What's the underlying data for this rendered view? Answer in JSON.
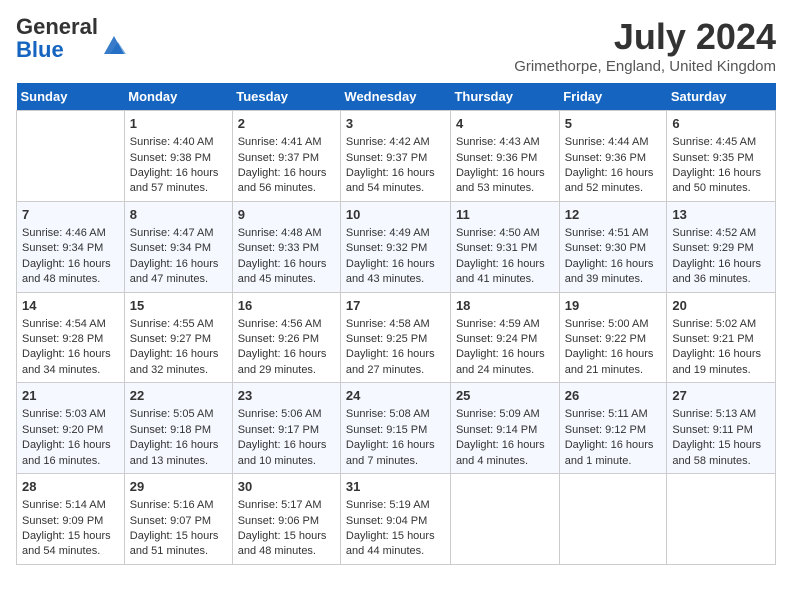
{
  "logo": {
    "general": "General",
    "blue": "Blue"
  },
  "title": "July 2024",
  "location": "Grimethorpe, England, United Kingdom",
  "days_of_week": [
    "Sunday",
    "Monday",
    "Tuesday",
    "Wednesday",
    "Thursday",
    "Friday",
    "Saturday"
  ],
  "weeks": [
    [
      {
        "day": "",
        "content": ""
      },
      {
        "day": "1",
        "content": "Sunrise: 4:40 AM\nSunset: 9:38 PM\nDaylight: 16 hours\nand 57 minutes."
      },
      {
        "day": "2",
        "content": "Sunrise: 4:41 AM\nSunset: 9:37 PM\nDaylight: 16 hours\nand 56 minutes."
      },
      {
        "day": "3",
        "content": "Sunrise: 4:42 AM\nSunset: 9:37 PM\nDaylight: 16 hours\nand 54 minutes."
      },
      {
        "day": "4",
        "content": "Sunrise: 4:43 AM\nSunset: 9:36 PM\nDaylight: 16 hours\nand 53 minutes."
      },
      {
        "day": "5",
        "content": "Sunrise: 4:44 AM\nSunset: 9:36 PM\nDaylight: 16 hours\nand 52 minutes."
      },
      {
        "day": "6",
        "content": "Sunrise: 4:45 AM\nSunset: 9:35 PM\nDaylight: 16 hours\nand 50 minutes."
      }
    ],
    [
      {
        "day": "7",
        "content": "Sunrise: 4:46 AM\nSunset: 9:34 PM\nDaylight: 16 hours\nand 48 minutes."
      },
      {
        "day": "8",
        "content": "Sunrise: 4:47 AM\nSunset: 9:34 PM\nDaylight: 16 hours\nand 47 minutes."
      },
      {
        "day": "9",
        "content": "Sunrise: 4:48 AM\nSunset: 9:33 PM\nDaylight: 16 hours\nand 45 minutes."
      },
      {
        "day": "10",
        "content": "Sunrise: 4:49 AM\nSunset: 9:32 PM\nDaylight: 16 hours\nand 43 minutes."
      },
      {
        "day": "11",
        "content": "Sunrise: 4:50 AM\nSunset: 9:31 PM\nDaylight: 16 hours\nand 41 minutes."
      },
      {
        "day": "12",
        "content": "Sunrise: 4:51 AM\nSunset: 9:30 PM\nDaylight: 16 hours\nand 39 minutes."
      },
      {
        "day": "13",
        "content": "Sunrise: 4:52 AM\nSunset: 9:29 PM\nDaylight: 16 hours\nand 36 minutes."
      }
    ],
    [
      {
        "day": "14",
        "content": "Sunrise: 4:54 AM\nSunset: 9:28 PM\nDaylight: 16 hours\nand 34 minutes."
      },
      {
        "day": "15",
        "content": "Sunrise: 4:55 AM\nSunset: 9:27 PM\nDaylight: 16 hours\nand 32 minutes."
      },
      {
        "day": "16",
        "content": "Sunrise: 4:56 AM\nSunset: 9:26 PM\nDaylight: 16 hours\nand 29 minutes."
      },
      {
        "day": "17",
        "content": "Sunrise: 4:58 AM\nSunset: 9:25 PM\nDaylight: 16 hours\nand 27 minutes."
      },
      {
        "day": "18",
        "content": "Sunrise: 4:59 AM\nSunset: 9:24 PM\nDaylight: 16 hours\nand 24 minutes."
      },
      {
        "day": "19",
        "content": "Sunrise: 5:00 AM\nSunset: 9:22 PM\nDaylight: 16 hours\nand 21 minutes."
      },
      {
        "day": "20",
        "content": "Sunrise: 5:02 AM\nSunset: 9:21 PM\nDaylight: 16 hours\nand 19 minutes."
      }
    ],
    [
      {
        "day": "21",
        "content": "Sunrise: 5:03 AM\nSunset: 9:20 PM\nDaylight: 16 hours\nand 16 minutes."
      },
      {
        "day": "22",
        "content": "Sunrise: 5:05 AM\nSunset: 9:18 PM\nDaylight: 16 hours\nand 13 minutes."
      },
      {
        "day": "23",
        "content": "Sunrise: 5:06 AM\nSunset: 9:17 PM\nDaylight: 16 hours\nand 10 minutes."
      },
      {
        "day": "24",
        "content": "Sunrise: 5:08 AM\nSunset: 9:15 PM\nDaylight: 16 hours\nand 7 minutes."
      },
      {
        "day": "25",
        "content": "Sunrise: 5:09 AM\nSunset: 9:14 PM\nDaylight: 16 hours\nand 4 minutes."
      },
      {
        "day": "26",
        "content": "Sunrise: 5:11 AM\nSunset: 9:12 PM\nDaylight: 16 hours\nand 1 minute."
      },
      {
        "day": "27",
        "content": "Sunrise: 5:13 AM\nSunset: 9:11 PM\nDaylight: 15 hours\nand 58 minutes."
      }
    ],
    [
      {
        "day": "28",
        "content": "Sunrise: 5:14 AM\nSunset: 9:09 PM\nDaylight: 15 hours\nand 54 minutes."
      },
      {
        "day": "29",
        "content": "Sunrise: 5:16 AM\nSunset: 9:07 PM\nDaylight: 15 hours\nand 51 minutes."
      },
      {
        "day": "30",
        "content": "Sunrise: 5:17 AM\nSunset: 9:06 PM\nDaylight: 15 hours\nand 48 minutes."
      },
      {
        "day": "31",
        "content": "Sunrise: 5:19 AM\nSunset: 9:04 PM\nDaylight: 15 hours\nand 44 minutes."
      },
      {
        "day": "",
        "content": ""
      },
      {
        "day": "",
        "content": ""
      },
      {
        "day": "",
        "content": ""
      }
    ]
  ]
}
